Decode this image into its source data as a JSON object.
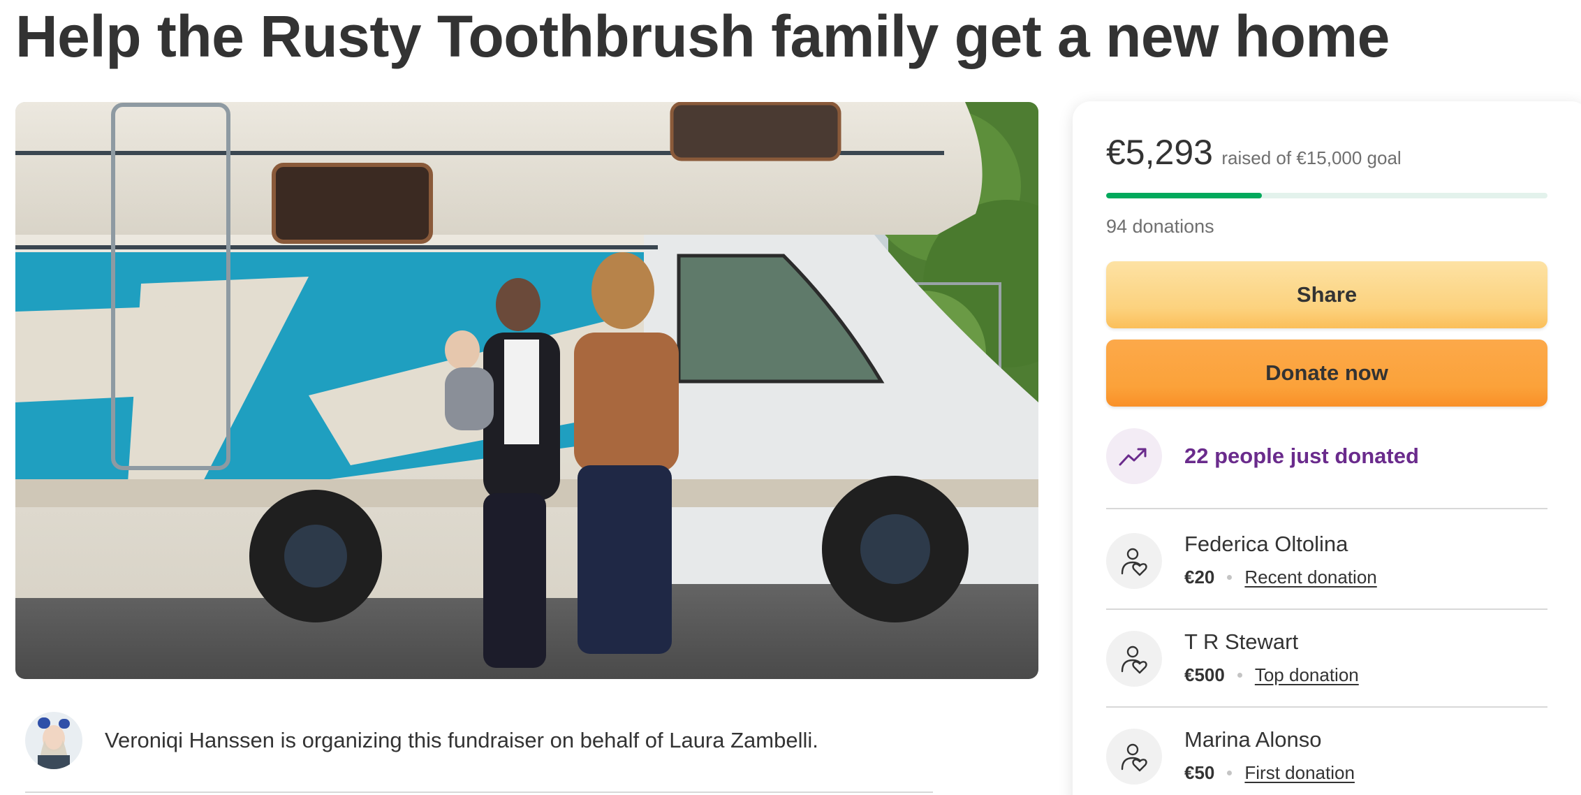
{
  "campaign": {
    "title": "Help the Rusty Toothbrush family get a new home"
  },
  "organizer": {
    "text": "Veroniqi Hanssen is organizing this fundraiser on behalf of Laura Zambelli."
  },
  "donation": {
    "raised": "€5,293",
    "goal_text": "raised of €15,000 goal",
    "progress_fraction": 0.353,
    "count_text": "94 donations",
    "share_label": "Share",
    "donate_label": "Donate now",
    "trending_text": "22 people just donated",
    "trending_icon": "trending-up-icon",
    "accent_color": "#02a95c",
    "trending_color": "#6a2b8c",
    "donors": [
      {
        "name": "Federica Oltolina",
        "amount": "€20",
        "tag": "Recent donation"
      },
      {
        "name": "T R Stewart",
        "amount": "€500",
        "tag": "Top donation"
      },
      {
        "name": "Marina Alonso",
        "amount": "€50",
        "tag": "First donation"
      }
    ]
  }
}
